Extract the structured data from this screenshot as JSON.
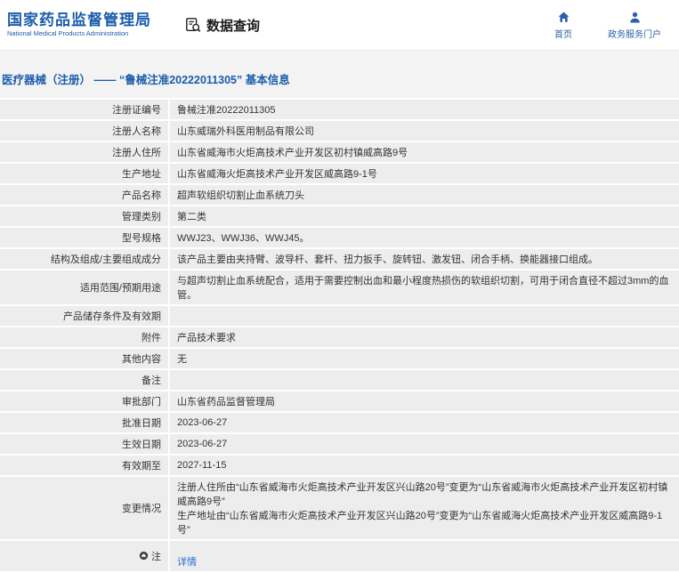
{
  "colors": {
    "accent": "#1a5dab",
    "link": "#1e6fd0",
    "page_background": "#f3f3f3",
    "row_background": "#ededed"
  },
  "header": {
    "org_name_cn": "国家药品监督管理局",
    "org_name_en": "National Medical Products Administration",
    "section_title": "数据查询",
    "nav": [
      {
        "label": "首页",
        "icon": "home-icon"
      },
      {
        "label": "政务服务门户",
        "icon": "user-icon"
      }
    ]
  },
  "page": {
    "title": "医疗器械（注册） —— “鲁械注准20222011305” 基本信息"
  },
  "table": {
    "rows": [
      {
        "label": "注册证编号",
        "value": "鲁械注准20222011305"
      },
      {
        "label": "注册人名称",
        "value": "山东威瑞外科医用制品有限公司"
      },
      {
        "label": "注册人住所",
        "value": "山东省威海市火炬高技术产业开发区初村镇威高路9号"
      },
      {
        "label": "生产地址",
        "value": "山东省威海火炬高技术产业开发区威高路9-1号"
      },
      {
        "label": "产品名称",
        "value": "超声软组织切割止血系统刀头"
      },
      {
        "label": "管理类别",
        "value": "第二类"
      },
      {
        "label": "型号规格",
        "value": "WWJ23、WWJ36、WWJ45。"
      },
      {
        "label": "结构及组成/主要组成成分",
        "value": "该产品主要由夹持臂、波导杆、套杆、扭力扳手、旋转钮、激发钮、闭合手柄、换能器接口组成。"
      },
      {
        "label": "适用范围/预期用途",
        "value": "与超声切割止血系统配合，适用于需要控制出血和最小程度热损伤的软组织切割，可用于闭合直径不超过3mm的血管。"
      },
      {
        "label": "产品储存条件及有效期",
        "value": ""
      },
      {
        "label": "附件",
        "value": "产品技术要求"
      },
      {
        "label": "其他内容",
        "value": "无"
      },
      {
        "label": "备注",
        "value": ""
      },
      {
        "label": "审批部门",
        "value": "山东省药品监督管理局"
      },
      {
        "label": "批准日期",
        "value": "2023-06-27"
      },
      {
        "label": "生效日期",
        "value": "2023-06-27"
      },
      {
        "label": "有效期至",
        "value": "2027-11-15"
      },
      {
        "label": "变更情况",
        "value": "注册人住所由“山东省威海市火炬高技术产业开发区兴山路20号”变更为“山东省威海市火炬高技术产业开发区初村镇威高路9号”\n生产地址由“山东省威海市火炬高技术产业开发区兴山路20号”变更为“山东省威海火炬高技术产业开发区威高路9-1号”"
      }
    ]
  },
  "note_row": {
    "label": "注",
    "link_label": "详情"
  }
}
